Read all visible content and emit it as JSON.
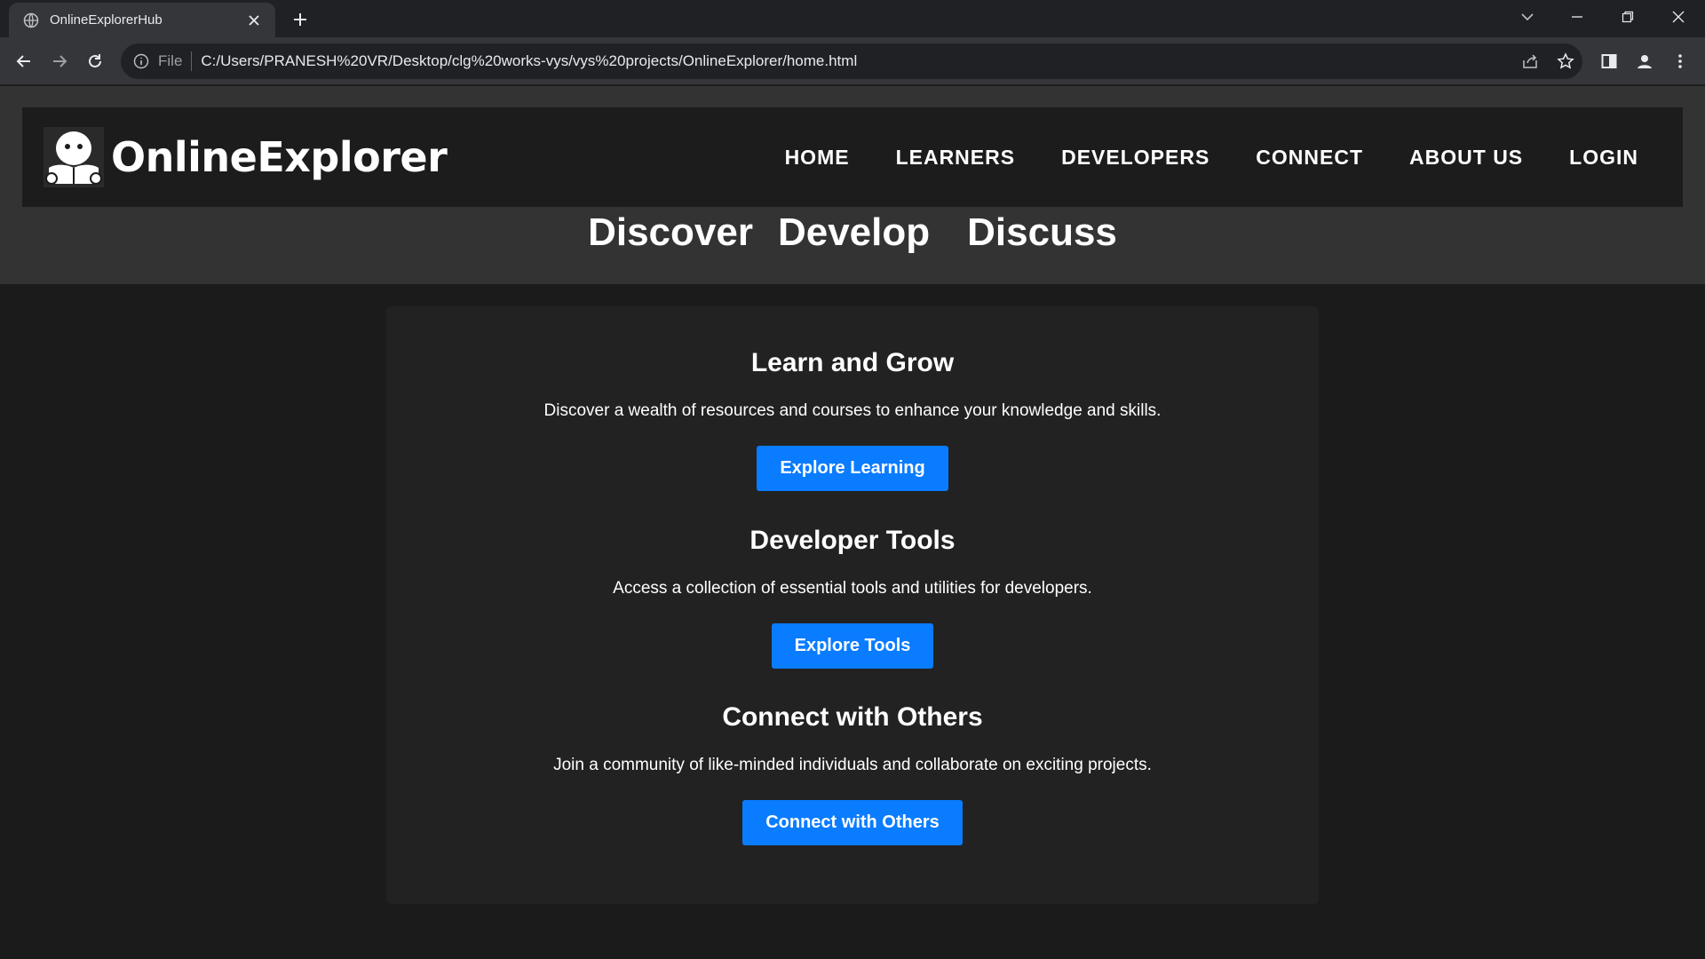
{
  "browser": {
    "tab_title": "OnlineExplorerHub",
    "scheme_label": "File",
    "url": "C:/Users/PRANESH%20VR/Desktop/clg%20works-vys/vys%20projects/OnlineExplorer/home.html"
  },
  "site": {
    "brand": "OnlineExplorer",
    "nav": [
      {
        "label": "HOME"
      },
      {
        "label": "LEARNERS"
      },
      {
        "label": "DEVELOPERS"
      },
      {
        "label": "CONNECT"
      },
      {
        "label": "ABOUT US"
      },
      {
        "label": "LOGIN"
      }
    ],
    "tagline": [
      "Discover",
      "Develop",
      "Discuss"
    ]
  },
  "sections": [
    {
      "title": "Learn and Grow",
      "text": "Discover a wealth of resources and courses to enhance your knowledge and skills.",
      "button": "Explore Learning"
    },
    {
      "title": "Developer Tools",
      "text": "Access a collection of essential tools and utilities for developers.",
      "button": "Explore Tools"
    },
    {
      "title": "Connect with Others",
      "text": "Join a community of like-minded individuals and collaborate on exciting projects.",
      "button": "Connect with Others"
    }
  ],
  "colors": {
    "accent": "#0a7cff",
    "header_bg": "#1c1c1c",
    "hero_bg": "#333333",
    "card_bg": "#222222",
    "page_bg": "#1b1b1b"
  }
}
